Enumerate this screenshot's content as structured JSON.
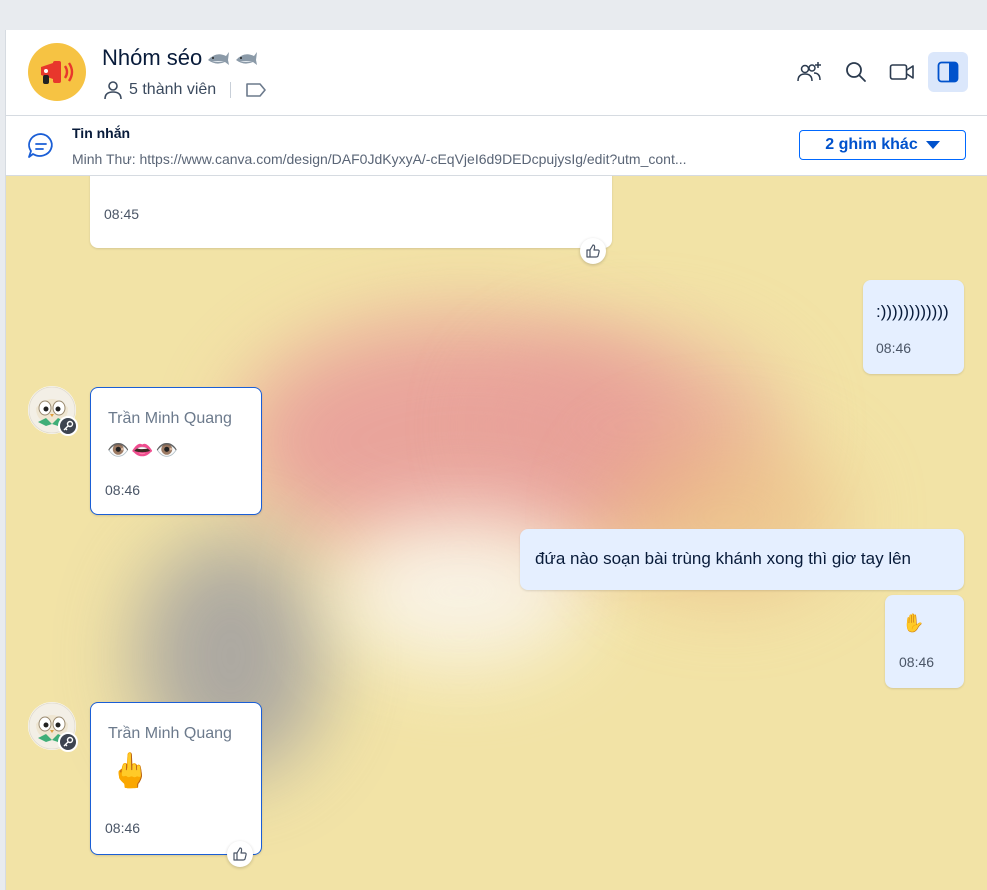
{
  "header": {
    "group_name": "Nhóm séo",
    "members": "5 thành viên",
    "icons": [
      "add-member-icon",
      "search-icon",
      "video-call-icon",
      "sidebar-toggle-icon"
    ]
  },
  "pinned": {
    "title": "Tin nhắn",
    "text": "Minh Thư: https://www.canva.com/design/DAF0JdKyxyA/-cEqVjeI6d9DEDcpujysIg/edit?utm_cont...",
    "more_button": "2 ghim khác"
  },
  "messages": [
    {
      "id": "m0",
      "time": "08:45"
    },
    {
      "id": "m1",
      "text": ":))))))))))))",
      "time": "08:46"
    },
    {
      "id": "m2",
      "sender": "Trần Minh Quang",
      "text": "👁️👄👁️",
      "time": "08:46"
    },
    {
      "id": "m3",
      "text": "đứa nào soạn bài trùng khánh xong thì giơ tay lên"
    },
    {
      "id": "m4",
      "text": "✋",
      "time": "08:46"
    },
    {
      "id": "m5",
      "sender": "Trần Minh Quang",
      "text": "🖕",
      "time": "08:46"
    }
  ],
  "colors": {
    "chat_background": "#f2e3a6",
    "my_bubble": "#e5efff",
    "accent": "#0068ff"
  }
}
